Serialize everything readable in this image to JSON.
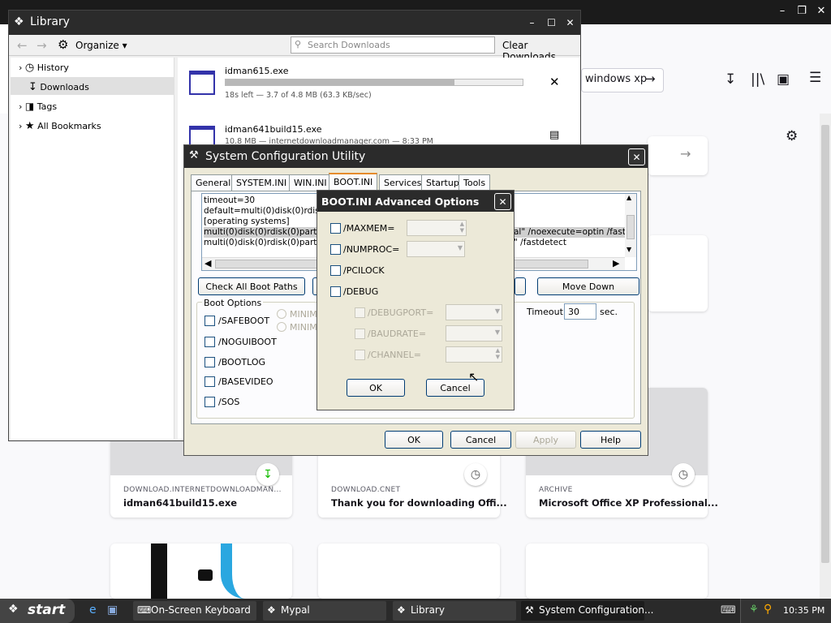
{
  "firefox": {
    "search_text": "windows xp",
    "cards": [
      {
        "source": "DOWNLOAD.INTERNETDOWNLOADMAN...",
        "title": "idman641build15.exe",
        "badge": "download-icon"
      },
      {
        "source": "DOWNLOAD.CNET",
        "title": "Thank you for downloading Offi...",
        "badge": "clock-icon"
      },
      {
        "source": "ARCHIVE",
        "title": "Microsoft Office XP Professional...",
        "badge": "clock-icon"
      }
    ]
  },
  "library": {
    "title": "Library",
    "organize_label": "Organize",
    "search_placeholder": "Search Downloads",
    "clear_label": "Clear Downloads",
    "sidebar": [
      {
        "label": "History",
        "icon": "clock-icon"
      },
      {
        "label": "Downloads",
        "icon": "download-icon"
      },
      {
        "label": "Tags",
        "icon": "tag-icon"
      },
      {
        "label": "All Bookmarks",
        "icon": "star-icon"
      }
    ],
    "downloads": [
      {
        "name": "idman615.exe",
        "status": "18s left — 3.7 of 4.8 MB (63.3 KB/sec)",
        "progress": 0.77
      },
      {
        "name": "idman641build15.exe",
        "status": "10.8 MB — internetdownloadmanager.com — 8:33 PM"
      }
    ]
  },
  "sysconfig": {
    "title": "System Configuration Utility",
    "tabs": [
      "General",
      "SYSTEM.INI",
      "WIN.INI",
      "BOOT.INI",
      "Services",
      "Startup",
      "Tools"
    ],
    "active_tab": "BOOT.INI",
    "boot_lines": [
      "timeout=30",
      "default=multi(0)disk(0)rdisk(0",
      "[operating systems]",
      "multi(0)disk(0)rdisk(0)partition",
      "multi(0)disk(0)rdisk(0)partition"
    ],
    "boot_lines_right": [
      "al\" /noexecute=optin /fastd",
      "\" /fastdetect"
    ],
    "check_all_label": "Check All Boot Paths",
    "move_down_label": "Move Down",
    "boot_options_label": "Boot Options",
    "options": [
      "/SAFEBOOT",
      "/NOGUIBOOT",
      "/BOOTLOG",
      "/BASEVIDEO",
      "/SOS"
    ],
    "radio_labels": [
      "MINIMA",
      "MINIMA"
    ],
    "timeout_label": "Timeout:",
    "timeout_value": "30",
    "timeout_unit": "sec.",
    "buttons": {
      "ok": "OK",
      "cancel": "Cancel",
      "apply": "Apply",
      "help": "Help"
    }
  },
  "advanced": {
    "title": "BOOT.INI Advanced Options",
    "options": [
      {
        "label": "/MAXMEM=",
        "enabled": true
      },
      {
        "label": "/NUMPROC=",
        "enabled": true
      },
      {
        "label": "/PCILOCK",
        "enabled": true
      },
      {
        "label": "/DEBUG",
        "enabled": true
      },
      {
        "label": "/DEBUGPORT=",
        "enabled": false
      },
      {
        "label": "/BAUDRATE=",
        "enabled": false
      },
      {
        "label": "/CHANNEL=",
        "enabled": false
      }
    ],
    "ok_label": "OK",
    "cancel_label": "Cancel"
  },
  "taskbar": {
    "start_label": "start",
    "tasks": [
      "On-Screen Keyboard",
      "Mypal",
      "Library",
      "System Configuration..."
    ],
    "clock": "10:35 PM"
  }
}
